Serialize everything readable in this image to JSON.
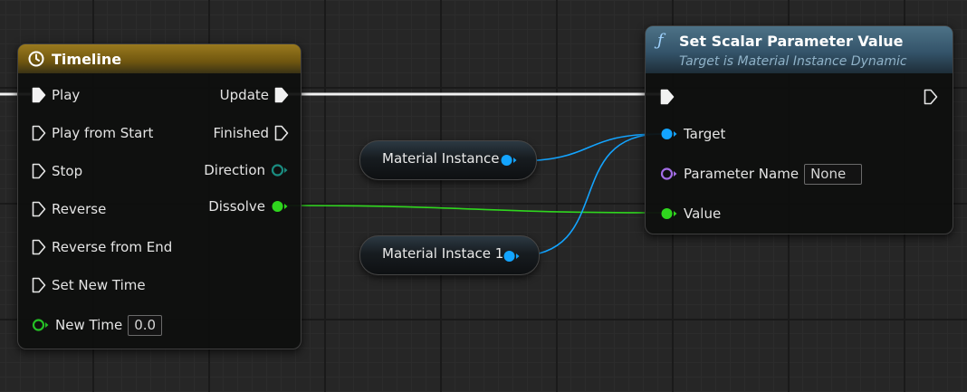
{
  "timeline_node": {
    "title": "Timeline",
    "header_color": "#8a6a12",
    "inputs": [
      {
        "label": "Play",
        "type": "exec"
      },
      {
        "label": "Play from Start",
        "type": "exec"
      },
      {
        "label": "Stop",
        "type": "exec"
      },
      {
        "label": "Reverse",
        "type": "exec"
      },
      {
        "label": "Reverse from End",
        "type": "exec"
      },
      {
        "label": "Set New Time",
        "type": "exec"
      }
    ],
    "new_time": {
      "label": "New Time",
      "value": "0.0",
      "pin_color": "#25c025"
    },
    "outputs": [
      {
        "label": "Update",
        "type": "exec"
      },
      {
        "label": "Finished",
        "type": "exec"
      },
      {
        "label": "Direction",
        "type": "data",
        "color": "#1a8c80"
      },
      {
        "label": "Dissolve",
        "type": "data",
        "color": "#2fd61e"
      }
    ]
  },
  "variables": [
    {
      "label": "Material Instance",
      "pin_color": "#13a4ff"
    },
    {
      "label": "Material Instace 1",
      "pin_color": "#13a4ff"
    }
  ],
  "set_scalar_node": {
    "icon": "ƒ",
    "title": "Set Scalar Parameter Value",
    "subtitle": "Target is Material Instance Dynamic",
    "header_color": "#38586d",
    "pins": {
      "target": {
        "label": "Target",
        "color": "#13a4ff"
      },
      "parameter_name": {
        "label": "Parameter Name",
        "value": "None",
        "color": "#a36de6"
      },
      "value": {
        "label": "Value",
        "color": "#2fd61e"
      }
    }
  },
  "wire_colors": {
    "exec": "#f2f2f2",
    "object": "#13a4ff",
    "float": "#2fd61e"
  }
}
